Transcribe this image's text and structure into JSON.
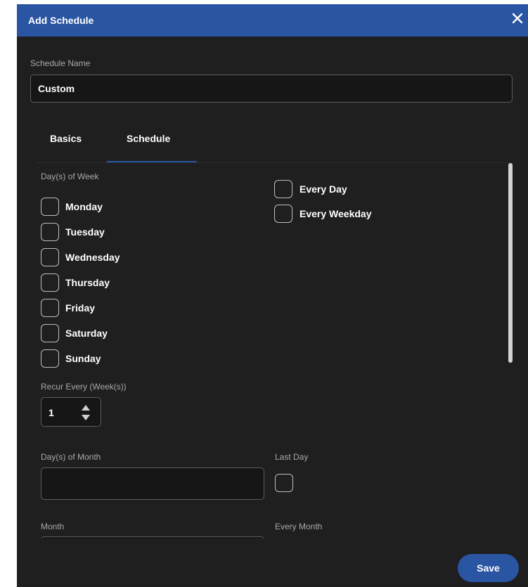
{
  "dialog": {
    "title": "Add Schedule",
    "close_icon": "close-icon"
  },
  "schedule_name": {
    "label": "Schedule Name",
    "value": "Custom"
  },
  "tabs": [
    {
      "label": "Basics",
      "active": false
    },
    {
      "label": "Schedule",
      "active": true
    }
  ],
  "days_of_week": {
    "label": "Day(s) of Week",
    "days": [
      {
        "label": "Monday",
        "checked": false
      },
      {
        "label": "Tuesday",
        "checked": false
      },
      {
        "label": "Wednesday",
        "checked": false
      },
      {
        "label": "Thursday",
        "checked": false
      },
      {
        "label": "Friday",
        "checked": false
      },
      {
        "label": "Saturday",
        "checked": false
      },
      {
        "label": "Sunday",
        "checked": false
      }
    ],
    "shortcuts": [
      {
        "label": "Every Day",
        "checked": false
      },
      {
        "label": "Every Weekday",
        "checked": false
      }
    ]
  },
  "recur": {
    "label": "Recur Every (Week(s))",
    "value": "1"
  },
  "days_of_month": {
    "label": "Day(s) of Month",
    "value": ""
  },
  "last_day": {
    "label": "Last Day",
    "checked": false
  },
  "month": {
    "label": "Month"
  },
  "every_month": {
    "label": "Every Month"
  },
  "footer": {
    "save_label": "Save"
  },
  "colors": {
    "header": "#2a55a3",
    "panel": "#1f1f1f",
    "input_bg": "#161616",
    "accent": "#2a55a3"
  }
}
